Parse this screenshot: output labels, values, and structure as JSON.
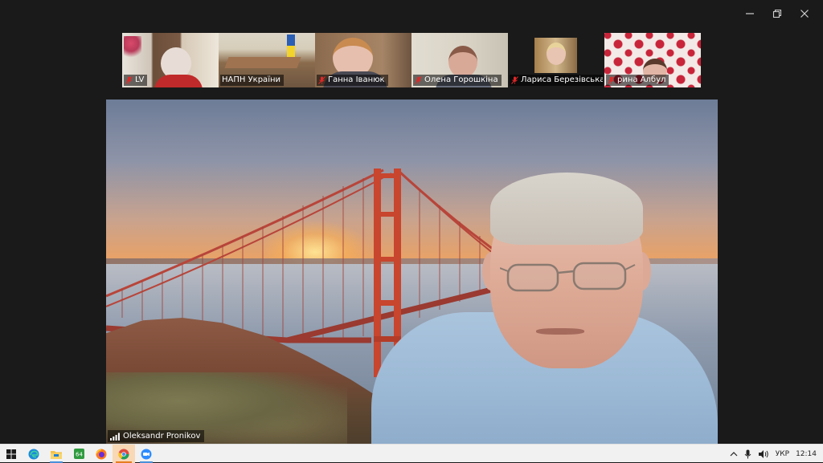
{
  "window": {
    "controls": [
      "minimize",
      "restore",
      "close"
    ]
  },
  "participants": [
    {
      "name": "LV",
      "muted": true
    },
    {
      "name": "НАПН України",
      "muted": false
    },
    {
      "name": "Ганна Іванюк",
      "muted": true
    },
    {
      "name": "Олена Горошкіна",
      "muted": true
    },
    {
      "name": "Лариса Березівська",
      "muted": true
    },
    {
      "name": "рина Албул",
      "muted": true
    }
  ],
  "speaker": {
    "name": "Oleksandr Pronikov"
  },
  "taskbar": {
    "apps": [
      "windows-start",
      "edge",
      "file-explorer",
      "app-64",
      "firefox",
      "chrome",
      "zoom"
    ],
    "active_app": "chrome",
    "tray": {
      "language": "УКР",
      "time": "12:14"
    }
  },
  "colors": {
    "window_bg": "#1a1a1a",
    "taskbar_bg": "#f1f1f1",
    "muted_red": "#e02828",
    "bridge_red": "#c8452e"
  }
}
